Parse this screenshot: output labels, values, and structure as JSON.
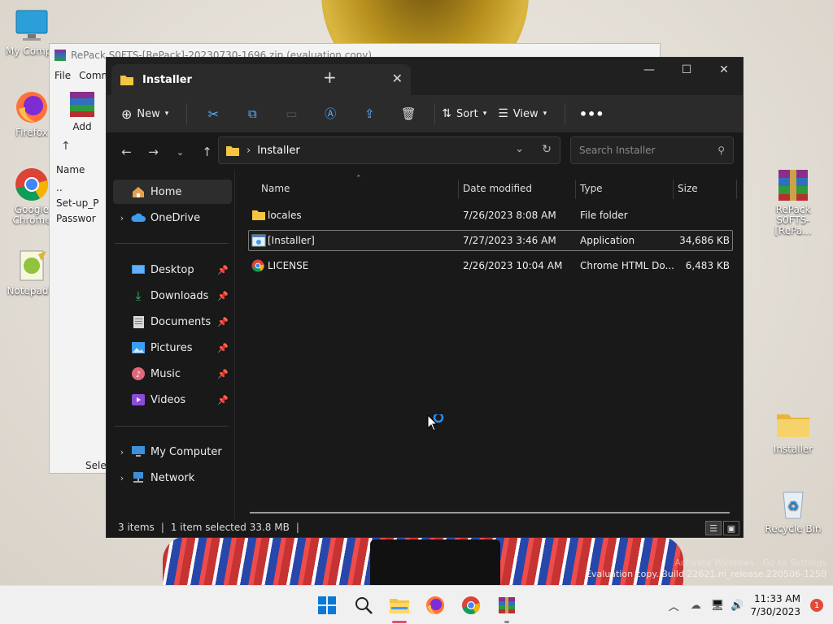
{
  "desktop": {
    "icons_left": [
      {
        "label": "My Compu",
        "icon": "monitor-icon"
      },
      {
        "label": "Firefox",
        "icon": "firefox-icon"
      },
      {
        "label": "Google Chrome",
        "icon": "chrome-icon"
      },
      {
        "label": "Notepad+",
        "icon": "notepad-icon"
      }
    ],
    "icons_right": [
      {
        "label": "RePack S0FTS-[RePa...",
        "icon": "winrar-archive-icon"
      },
      {
        "label": "Installer",
        "icon": "folder-icon"
      },
      {
        "label": "Recycle Bin",
        "icon": "recycle-bin-icon"
      }
    ],
    "watermark": {
      "line1": "Activate Windows · Go to Settings",
      "line2": "Evaluation copy. Build 22621.ni_release.220506-1250"
    }
  },
  "winrar": {
    "title": "RePack S0FTS-[RePack]-20230730-1696.zip (evaluation copy)",
    "menu": [
      "File",
      "Comm"
    ],
    "add_label": "Add",
    "name_header": "Name",
    "rows": [
      "..",
      "Set-up_P",
      "Passwor"
    ],
    "status": "Sele"
  },
  "explorer": {
    "tab_title": "Installer",
    "new_label": "New",
    "sort_label": "Sort",
    "view_label": "View",
    "path": "Installer",
    "search_placeholder": "Search Installer",
    "nav": [
      {
        "label": "Home"
      },
      {
        "label": "OneDrive"
      },
      {
        "label": "Desktop"
      },
      {
        "label": "Downloads"
      },
      {
        "label": "Documents"
      },
      {
        "label": "Pictures"
      },
      {
        "label": "Music"
      },
      {
        "label": "Videos"
      },
      {
        "label": "My Computer"
      },
      {
        "label": "Network"
      }
    ],
    "columns": [
      "Name",
      "Date modified",
      "Type",
      "Size"
    ],
    "files": [
      {
        "name": "locales",
        "date": "7/26/2023 8:08 AM",
        "type": "File folder",
        "size": ""
      },
      {
        "name": "[Installer]",
        "date": "7/27/2023 3:46 AM",
        "type": "Application",
        "size": "34,686 KB"
      },
      {
        "name": "LICENSE",
        "date": "2/26/2023 10:04 AM",
        "type": "Chrome HTML Do...",
        "size": "6,483 KB"
      }
    ],
    "status": {
      "count": "3 items",
      "selected": "1 item selected  33.8 MB"
    }
  },
  "taskbar": {
    "time": "11:33 AM",
    "date": "7/30/2023",
    "notifications": "1"
  },
  "colors": {
    "accent": "#0078d4",
    "folder": "#f5c542",
    "explorer_bg": "#191919"
  }
}
